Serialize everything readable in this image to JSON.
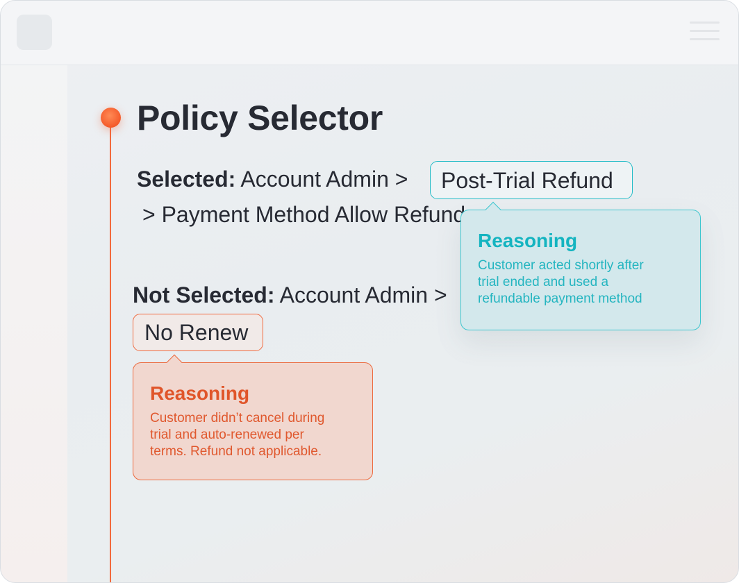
{
  "header": {
    "logo_icon": "app-logo-placeholder",
    "menu_icon": "hamburger-menu-icon"
  },
  "main": {
    "title": "Policy Selector",
    "selected": {
      "label": "Selected:",
      "path_start": "Account Admin >",
      "chip": "Post-Trial Refund",
      "path_end": "> Payment Method Allow Refund",
      "reasoning_heading": "Reasoning",
      "reasoning_lines": [
        "Customer acted shortly after",
        "trial ended and used a",
        "refundable payment method"
      ]
    },
    "not_selected": {
      "label": "Not Selected:",
      "path_start": "Account Admin >",
      "chip": "No Renew",
      "reasoning_heading": "Reasoning",
      "reasoning_lines": [
        "Customer didn’t cancel during",
        "trial and auto-renewed per",
        "terms. Refund not applicable."
      ]
    }
  },
  "colors": {
    "accent_teal": "#23bcc7",
    "accent_orange": "#f26a3d",
    "text_dark": "#272a33"
  }
}
